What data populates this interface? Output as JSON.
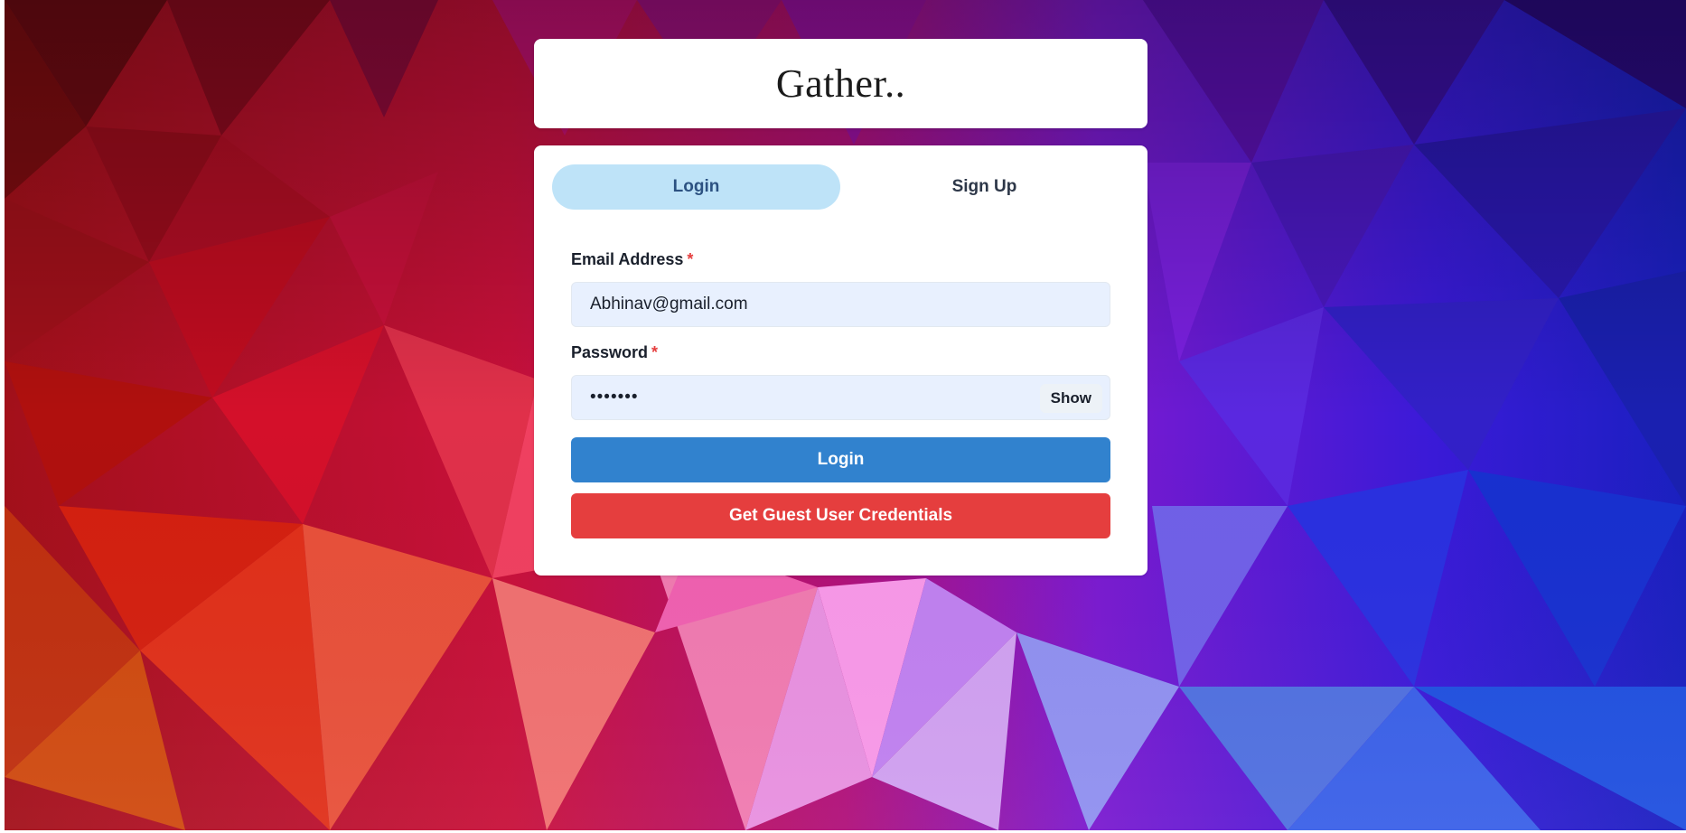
{
  "app": {
    "logo_text": "Gather.."
  },
  "tabs": [
    {
      "label": "Login",
      "active": true
    },
    {
      "label": "Sign Up",
      "active": false
    }
  ],
  "form": {
    "email": {
      "label": "Email Address",
      "required_mark": "*",
      "value": "Abhinav@gmail.com"
    },
    "password": {
      "label": "Password",
      "required_mark": "*",
      "value_masked": "•••••••",
      "show_label": "Show"
    },
    "login_button": "Login",
    "guest_button": "Get Guest User Credentials"
  },
  "colors": {
    "tab_active_bg": "#bee3f8",
    "input_bg": "#e8f0fe",
    "login_button": "#3182ce",
    "guest_button": "#e53e3e",
    "required_mark": "#e53e3e"
  }
}
